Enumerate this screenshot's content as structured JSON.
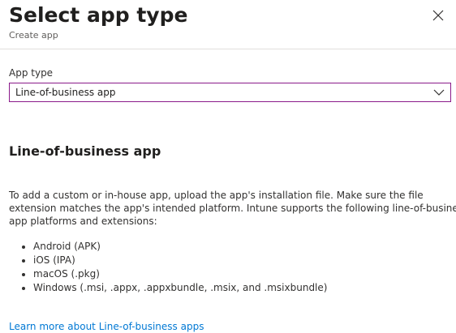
{
  "header": {
    "title": "Select app type",
    "subtitle": "Create app",
    "close_icon": "close-icon"
  },
  "form": {
    "app_type_label": "App type",
    "app_type_value": "Line-of-business app",
    "dropdown_icon": "chevron-down-icon"
  },
  "content": {
    "heading": "Line-of-business app",
    "description_lines": [
      "To add a custom or in-house app, upload the app's installation file. Make sure the file",
      "extension matches the app's intended platform. Intune supports the following line-of-business",
      "app platforms and extensions:"
    ],
    "platforms": [
      "Android (APK)",
      "iOS (IPA)",
      "macOS (.pkg)",
      "Windows (.msi, .appx, .appxbundle, .msix, and .msixbundle)"
    ],
    "learn_more_link": "Learn more about Line-of-business apps"
  },
  "colors": {
    "accent_border": "#8a1a8a",
    "link": "#0078d4"
  }
}
